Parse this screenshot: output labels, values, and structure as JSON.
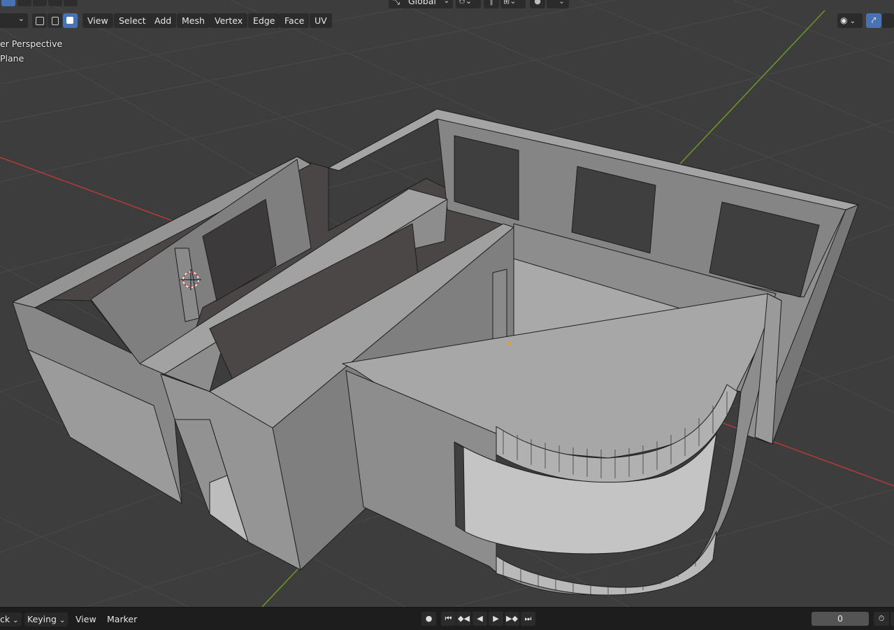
{
  "header": {
    "top_left_dropdown_value": "",
    "orientation_value": "Global",
    "menus": [
      {
        "label": "View"
      },
      {
        "label": "Select"
      },
      {
        "label": "Add"
      },
      {
        "label": "Mesh"
      },
      {
        "label": "Vertex"
      },
      {
        "label": "Edge"
      },
      {
        "label": "Face"
      },
      {
        "label": "UV"
      }
    ],
    "select_modes": [
      "vertex-select-mode-icon",
      "edge-select-mode-icon",
      "face-select-mode-icon"
    ],
    "active_select_mode": "face"
  },
  "viewport": {
    "view_name": "er Perspective",
    "object_name": "Plane",
    "axis_colors": {
      "x": "#b53a3a",
      "y": "#6a9a25"
    },
    "background": "#3d3d3d",
    "wall_color": "#9a9a9a"
  },
  "timeline": {
    "playback_label": "ck",
    "keying_label": "Keying",
    "view_label": "View",
    "marker_label": "Marker",
    "current_frame": "0"
  }
}
